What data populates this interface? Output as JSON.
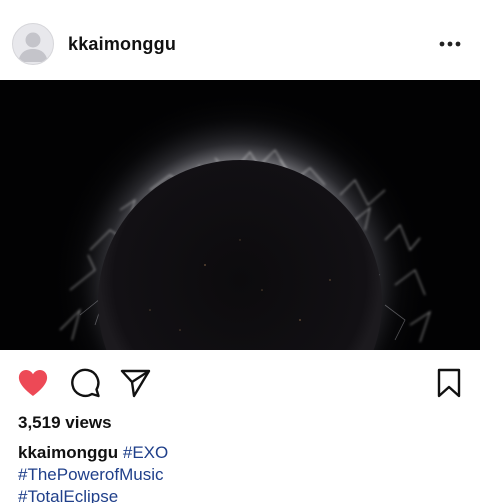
{
  "post": {
    "username": "kkaimonggu",
    "more_icon": "more-horizontal-icon",
    "avatar_icon": "default-avatar-icon"
  },
  "media": {
    "kind": "video-frame",
    "description_icon": "eclipse-image"
  },
  "actions": {
    "like_icon": "heart-filled-icon",
    "like_color": "#ed4956",
    "comment_icon": "comment-icon",
    "share_icon": "paper-plane-icon",
    "save_icon": "bookmark-icon"
  },
  "stats": {
    "views": "3,519 views"
  },
  "caption": {
    "username": "kkaimonggu",
    "hashtags": [
      "#EXO",
      "#ThePowerofMusic",
      "#TotalEclipse"
    ],
    "hashtag_color": "#1f3f8a"
  }
}
